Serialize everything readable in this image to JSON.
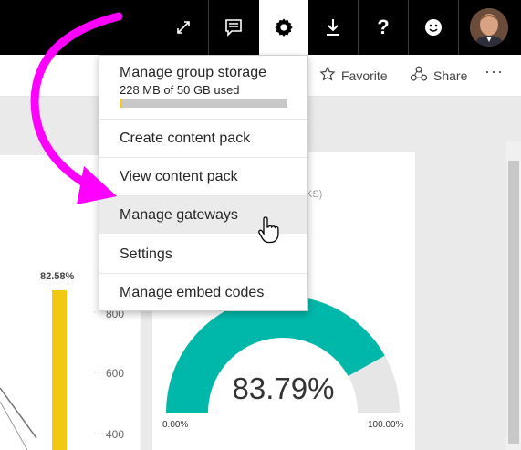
{
  "colors": {
    "topbar": "#000000",
    "accent_yellow": "#f2c811",
    "gauge_teal": "#00b8aa",
    "gauge_track": "#e6e6e6",
    "arrow_magenta": "#ff00ff"
  },
  "topbar": {
    "icons": [
      "expand-icon",
      "feedback-icon",
      "gear-icon",
      "download-icon",
      "help-icon",
      "smiley-icon"
    ],
    "help_label": "?"
  },
  "toolbar": {
    "favorite_label": "Favorite",
    "share_label": "Share",
    "more_label": "···"
  },
  "menu": {
    "storage": {
      "title": "Manage group storage",
      "usage": "228 MB of 50 GB used",
      "used_fraction": 0.0046
    },
    "items": [
      {
        "label": "Create content pack"
      },
      {
        "label": "View content pack"
      },
      {
        "label": "Manage gateways"
      },
      {
        "label": "Settings"
      },
      {
        "label": "Manage embed codes"
      }
    ]
  },
  "left_tile": {
    "bar_label": "82.58%",
    "axis_ticks": [
      "800",
      "600",
      "400"
    ]
  },
  "gauge_tile": {
    "title_fragment": "KS)",
    "value_label": "83.79%",
    "value_fraction": 0.8379,
    "min_label": "0.00%",
    "max_label": "100.00%"
  }
}
